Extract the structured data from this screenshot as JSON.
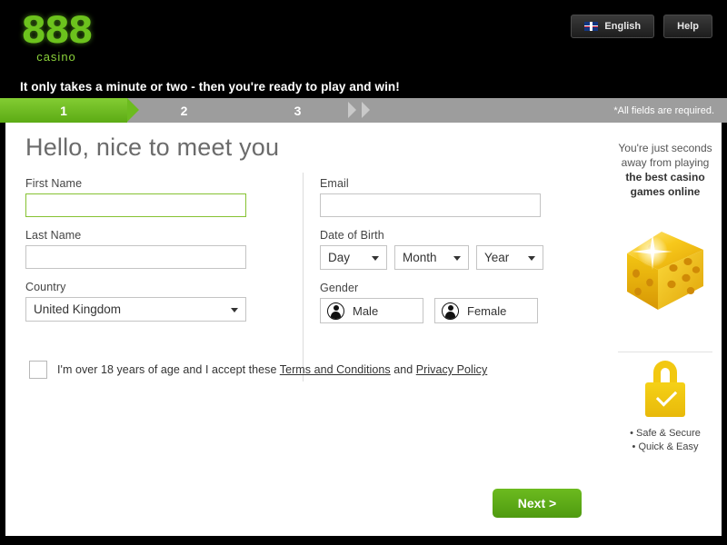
{
  "header": {
    "logo_main": "888",
    "logo_sub": "casino",
    "language_button": "English",
    "language_flag_icon": "uk-flag-icon",
    "help_button": "Help"
  },
  "tagline": "It only takes a minute or two - then you're ready to play and win!",
  "progress": {
    "steps": [
      {
        "number": "1",
        "active": true
      },
      {
        "number": "2",
        "active": false
      },
      {
        "number": "3",
        "active": false
      }
    ],
    "required_note": "*All fields are required."
  },
  "form": {
    "title": "Hello, nice to meet you",
    "first_name": {
      "label": "First Name",
      "value": "",
      "placeholder": ""
    },
    "last_name": {
      "label": "Last Name",
      "value": "",
      "placeholder": ""
    },
    "country": {
      "label": "Country",
      "value": "United Kingdom"
    },
    "email": {
      "label": "Email",
      "value": "",
      "placeholder": ""
    },
    "date_of_birth": {
      "label": "Date of Birth",
      "day": "Day",
      "month": "Month",
      "year": "Year"
    },
    "gender": {
      "label": "Gender",
      "male": "Male",
      "female": "Female"
    },
    "terms": {
      "text_before": "I'm over 18 years of age and I accept these ",
      "link_terms": "Terms and Conditions",
      "text_middle": " and ",
      "link_privacy": "Privacy Policy"
    },
    "next_button": "Next >"
  },
  "sidebar": {
    "promo_line1": "You're just seconds",
    "promo_line2": "away from playing",
    "promo_line3": "the best casino",
    "promo_line4": "games online",
    "dice_icon": "golden-dice-icon",
    "lock_icon": "padlock-secure-icon",
    "safety_line1": "• Safe & Secure",
    "safety_line2": "• Quick & Easy"
  },
  "colors": {
    "brand_green": "#6cbb1f",
    "logo_green": "#6cc21d",
    "steps_gray": "#9d9d9d",
    "lock_yellow": "#f2c811",
    "dice_gold": "#f0b90b",
    "title_gray": "#6b6b6b"
  }
}
